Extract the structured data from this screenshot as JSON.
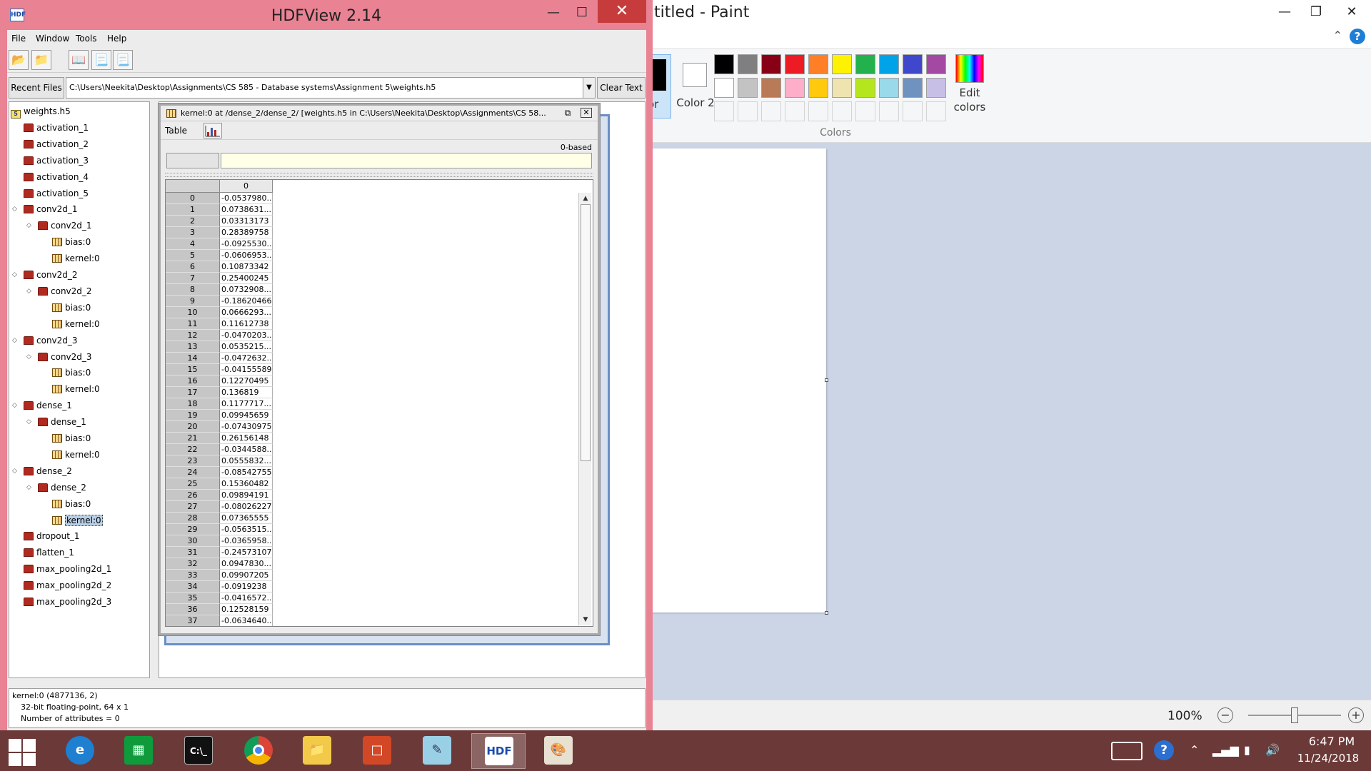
{
  "paint": {
    "title": "Untitled - Paint",
    "visible_title": "titled - Paint",
    "color1_label": "or",
    "color2_label": "Color 2",
    "edit_colors_label": "Edit colors",
    "colors_group_label": "Colors",
    "palette_row1": [
      "#000000",
      "#7f7f7f",
      "#880015",
      "#ed1c24",
      "#ff7f27",
      "#fff200",
      "#22b14c",
      "#00a2e8",
      "#3f48cc",
      "#a349a4"
    ],
    "palette_row2": [
      "#ffffff",
      "#c3c3c3",
      "#b97a57",
      "#ffaec9",
      "#ffc90e",
      "#efe4b0",
      "#b5e61d",
      "#99d9ea",
      "#7092be",
      "#c8bfe7"
    ],
    "zoom_level": "100%"
  },
  "hdf": {
    "title": "HDFView 2.14",
    "menu": [
      "File",
      "Window",
      "Tools",
      "Help"
    ],
    "recent_files_label": "Recent Files",
    "path_value": "C:\\Users\\Neekita\\Desktop\\Assignments\\CS 585 - Database systems\\Assignment 5\\weights.h5",
    "clear_text_label": "Clear Text",
    "tree": {
      "root": "weights.h5",
      "nodes": [
        "activation_1",
        "activation_2",
        "activation_3",
        "activation_4",
        "activation_5",
        "conv2d_1",
        "conv2d_1",
        "bias:0",
        "kernel:0",
        "conv2d_2",
        "conv2d_2",
        "bias:0",
        "kernel:0",
        "conv2d_3",
        "conv2d_3",
        "bias:0",
        "kernel:0",
        "dense_1",
        "dense_1",
        "bias:0",
        "kernel:0",
        "dense_2",
        "dense_2",
        "bias:0",
        "kernel:0",
        "dropout_1",
        "flatten_1",
        "max_pooling2d_1",
        "max_pooling2d_2",
        "max_pooling2d_3"
      ]
    },
    "status": {
      "line1": "kernel:0 (4877136, 2)",
      "line2": "32-bit floating-point,    64 x 1",
      "line3": "Number of attributes = 0"
    }
  },
  "dataset": {
    "title": "kernel:0  at  /dense_2/dense_2/  [weights.h5  in  C:\\Users\\Neekita\\Desktop\\Assignments\\CS 58...",
    "table_menu": "Table",
    "index_base": "0-based",
    "column_header": "0",
    "row_indices": [
      "0",
      "1",
      "2",
      "3",
      "4",
      "5",
      "6",
      "7",
      "8",
      "9",
      "10",
      "11",
      "12",
      "13",
      "14",
      "15",
      "16",
      "17",
      "18",
      "19",
      "20",
      "21",
      "22",
      "23",
      "24",
      "25",
      "26",
      "27",
      "28",
      "29",
      "30",
      "31",
      "32",
      "33",
      "34",
      "35",
      "36",
      "37"
    ],
    "values": [
      "-0.0537980...",
      "0.0738631...",
      "0.03313173",
      "0.28389758",
      "-0.0925530...",
      "-0.0606953...",
      "0.10873342",
      "0.25400245",
      "0.0732908...",
      "-0.18620466",
      "0.0666293...",
      "0.11612738",
      "-0.0470203...",
      "0.0535215...",
      "-0.0472632...",
      "-0.04155589",
      "0.12270495",
      "0.136819",
      "0.1177717...",
      "0.09945659",
      "-0.07430975",
      "0.26156148",
      "-0.0344588...",
      "0.0555832...",
      "-0.08542755",
      "0.15360482",
      "0.09894191",
      "-0.08026227",
      "0.07365555",
      "-0.0563515...",
      "-0.0365958...",
      "-0.24573107",
      "0.0947830...",
      "0.09907205",
      "-0.0919238",
      "-0.0416572...",
      "0.12528159",
      "-0.0634640..."
    ]
  },
  "taskbar": {
    "time": "6:47 PM",
    "date": "11/24/2018",
    "apps": [
      "internet-explorer",
      "store",
      "command-prompt",
      "chrome",
      "file-explorer",
      "office",
      "notepad",
      "hdfview",
      "paint"
    ]
  }
}
